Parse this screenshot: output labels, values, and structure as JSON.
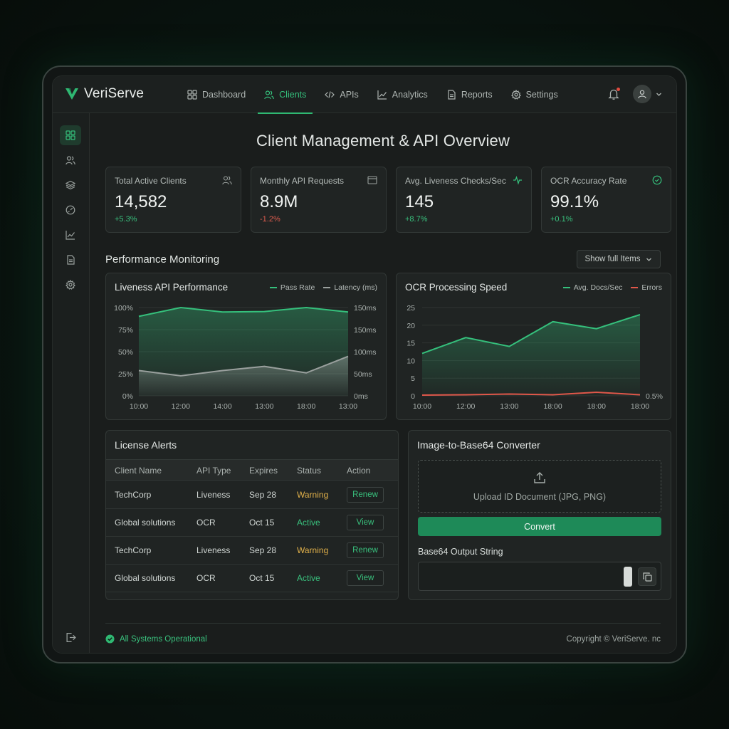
{
  "brand": {
    "name": "VeriServe",
    "accent": "#2fb872"
  },
  "nav": {
    "items": [
      {
        "label": "Dashboard",
        "icon": "grid-icon"
      },
      {
        "label": "Clients",
        "icon": "users-icon",
        "active": true
      },
      {
        "label": "APIs",
        "icon": "code-icon"
      },
      {
        "label": "Analytics",
        "icon": "line-chart-icon"
      },
      {
        "label": "Reports",
        "icon": "document-icon"
      },
      {
        "label": "Settings",
        "icon": "gear-icon"
      }
    ]
  },
  "page": {
    "title": "Client Management & API Overview"
  },
  "kpis": [
    {
      "label": "Total Active Clients",
      "value": "14,582",
      "change": "+5.3%",
      "icon": "users-icon"
    },
    {
      "label": "Monthly API Requests",
      "value": "8.9M",
      "change": "-1.2%",
      "icon": "window-icon"
    },
    {
      "label": "Avg. Liveness Checks/Sec",
      "value": "145",
      "change": "+8.7%",
      "icon": "pulse-icon"
    },
    {
      "label": "OCR Accuracy Rate",
      "value": "99.1%",
      "change": "+0.1%",
      "icon": "check-circle-icon"
    }
  ],
  "performance": {
    "title": "Performance Monitoring",
    "show_button": "Show full Items"
  },
  "chart_data": [
    {
      "type": "area",
      "title": "Liveness API Performance",
      "x": [
        "10:00",
        "12:00",
        "14:00",
        "13:00",
        "18:00",
        "13:00"
      ],
      "series": [
        {
          "name": "Pass Rate",
          "axis": "left",
          "color": "#35c07c",
          "values": [
            90,
            100,
            95,
            95.5,
            100,
            95
          ]
        },
        {
          "name": "Latency (ms)",
          "axis": "right",
          "color": "#9aa09e",
          "values": [
            43,
            34,
            43,
            50,
            39,
            67
          ]
        }
      ],
      "y_left_ticks": [
        "100%",
        "75%",
        "50%",
        "25%",
        "0%"
      ],
      "y_right_ticks": [
        "150ms",
        "150ms",
        "100ms",
        "50ms",
        "0ms"
      ],
      "ylim_left": [
        0,
        100
      ],
      "ylim_right": [
        0,
        150
      ],
      "grid": true
    },
    {
      "type": "area",
      "title": "OCR Processing Speed",
      "x": [
        "10:00",
        "12:00",
        "13:00",
        "18:00",
        "18:00",
        "18:00"
      ],
      "series": [
        {
          "name": "Avg. Docs/Sec",
          "color": "#35c07c",
          "values": [
            12,
            16.5,
            14,
            21,
            19,
            23
          ]
        },
        {
          "name": "Errors",
          "color": "#e0574a",
          "values": [
            0.2,
            0.3,
            0.5,
            0.3,
            1.0,
            0.3
          ]
        }
      ],
      "y_ticks": [
        "25",
        "20",
        "15",
        "10",
        "5",
        "0"
      ],
      "ylim": [
        0,
        25
      ],
      "end_label": "0.5%",
      "grid": true
    }
  ],
  "alerts": {
    "title": "License Alerts",
    "columns": [
      "Client Name",
      "API Type",
      "Expires",
      "Status",
      "Action"
    ],
    "rows": [
      {
        "client": "TechCorp",
        "api": "Liveness",
        "expires": "Sep 28",
        "status": "Warning",
        "action": "Renew"
      },
      {
        "client": "Global solutions",
        "api": "OCR",
        "expires": "Oct 15",
        "status": "Active",
        "action": "View"
      },
      {
        "client": "TechCorp",
        "api": "Liveness",
        "expires": "Sep 28",
        "status": "Warning",
        "action": "Renew"
      },
      {
        "client": "Global solutions",
        "api": "OCR",
        "expires": "Oct 15",
        "status": "Active",
        "action": "View"
      }
    ]
  },
  "converter": {
    "title": "Image-to-Base64 Converter",
    "upload_text": "Upload ID Document (JPG, PNG)",
    "convert_label": "Convert",
    "output_label": "Base64 Output String",
    "output_value": ""
  },
  "footer": {
    "status": "All Systems Operational",
    "copyright": "Copyright © VeriServe. nc"
  }
}
